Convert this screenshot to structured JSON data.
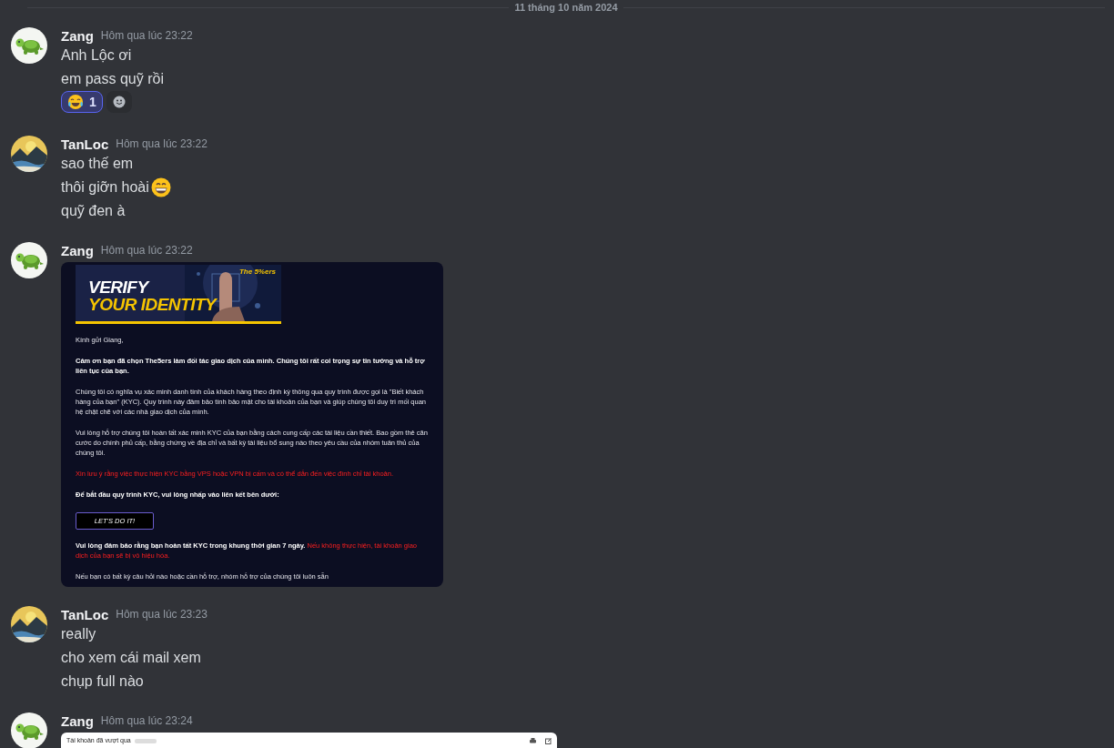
{
  "date_divider": {
    "text": "11 tháng 10 năm 2024"
  },
  "messages": [
    {
      "author": "Zang",
      "avatar": {
        "kind": "turtle"
      },
      "time": "Hôm qua lúc 23:22",
      "lines": [
        {
          "text": "Anh Lộc ơi"
        },
        {
          "text": "em pass quỹ rồi"
        }
      ],
      "reactions": [
        {
          "kind": "laughing",
          "count": "1",
          "selected": true
        }
      ]
    },
    {
      "author": "TanLoc",
      "avatar": {
        "kind": "landscape"
      },
      "time": "Hôm qua lúc 23:22",
      "lines": [
        {
          "text": "sao thế em"
        },
        {
          "text": "thôi giỡn hoài",
          "emoji": {
            "kind": "grinning"
          }
        },
        {
          "text": "quỹ đen à"
        }
      ]
    },
    {
      "author": "Zang",
      "avatar": {
        "kind": "turtle"
      },
      "time": "Hôm qua lúc 23:22",
      "attachment": {
        "kind": "email-image",
        "banner": {
          "line1": "VERIFY",
          "line2": "YOUR IDENTITY",
          "logo": "The 5%ers"
        },
        "blocks": [
          {
            "kind": "plain",
            "text": "Kính gửi Giang,"
          },
          {
            "kind": "bold",
            "text": "Cảm ơn bạn đã chọn The5ers làm đối tác giao dịch của mình. Chúng tôi rất coi trọng sự tin tưởng và hỗ trợ liên tục của bạn."
          },
          {
            "kind": "plain",
            "text": "Chúng tôi có nghĩa vụ xác minh danh tính của khách hàng theo định kỳ thông qua quy trình được gọi là \"Biết khách hàng của bạn\" (KYC). Quy trình này đảm bảo tính bảo mật cho tài khoản của bạn và giúp chúng tôi duy trì mối quan hệ chặt chẽ với các nhà giao dịch của mình."
          },
          {
            "kind": "plain",
            "text": "Vui lòng hỗ trợ chúng tôi hoàn tất xác minh KYC của bạn bằng cách cung cấp các tài liệu cần thiết. Bao gồm thẻ căn cước do chính phủ cấp, bằng chứng về địa chỉ và bất kỳ tài liệu bổ sung nào theo yêu cầu của nhóm tuân thủ của chúng tôi."
          },
          {
            "kind": "alert",
            "text": "Xin lưu ý rằng việc thực hiện KYC bằng VPS hoặc VPN bị cấm và có thể dẫn đến việc đình chỉ tài khoản."
          },
          {
            "kind": "bold",
            "text": "Để bắt đầu quy trình KYC, vui lòng nhấp vào liên kết bên dưới:"
          },
          {
            "kind": "button",
            "text": "LET'S DO IT!"
          },
          {
            "kind": "mixed",
            "parts": [
              {
                "kind": "bold",
                "text": "Vui lòng đảm bảo rằng bạn hoàn tất KYC trong khung thời gian 7 ngày. "
              },
              {
                "kind": "alert",
                "text": "Nếu không thực hiện, tài khoản giao dịch của bạn sẽ bị vô hiệu hóa."
              }
            ]
          },
          {
            "kind": "plain",
            "text": "Nếu bạn có bất kỳ câu hỏi nào hoặc cần hỗ trợ, nhóm hỗ trợ của chúng tôi luôn sẵn"
          }
        ]
      }
    },
    {
      "author": "TanLoc",
      "avatar": {
        "kind": "landscape"
      },
      "time": "Hôm qua lúc 23:23",
      "lines": [
        {
          "text": "really"
        },
        {
          "text": "cho xem cái mail xem"
        },
        {
          "text": "chụp full nào"
        }
      ]
    },
    {
      "author": "Zang",
      "avatar": {
        "kind": "turtle"
      },
      "time": "Hôm qua lúc 23:24",
      "attachment": {
        "kind": "email-preview",
        "title": "Tài khoản đã vượt qua"
      }
    }
  ]
}
